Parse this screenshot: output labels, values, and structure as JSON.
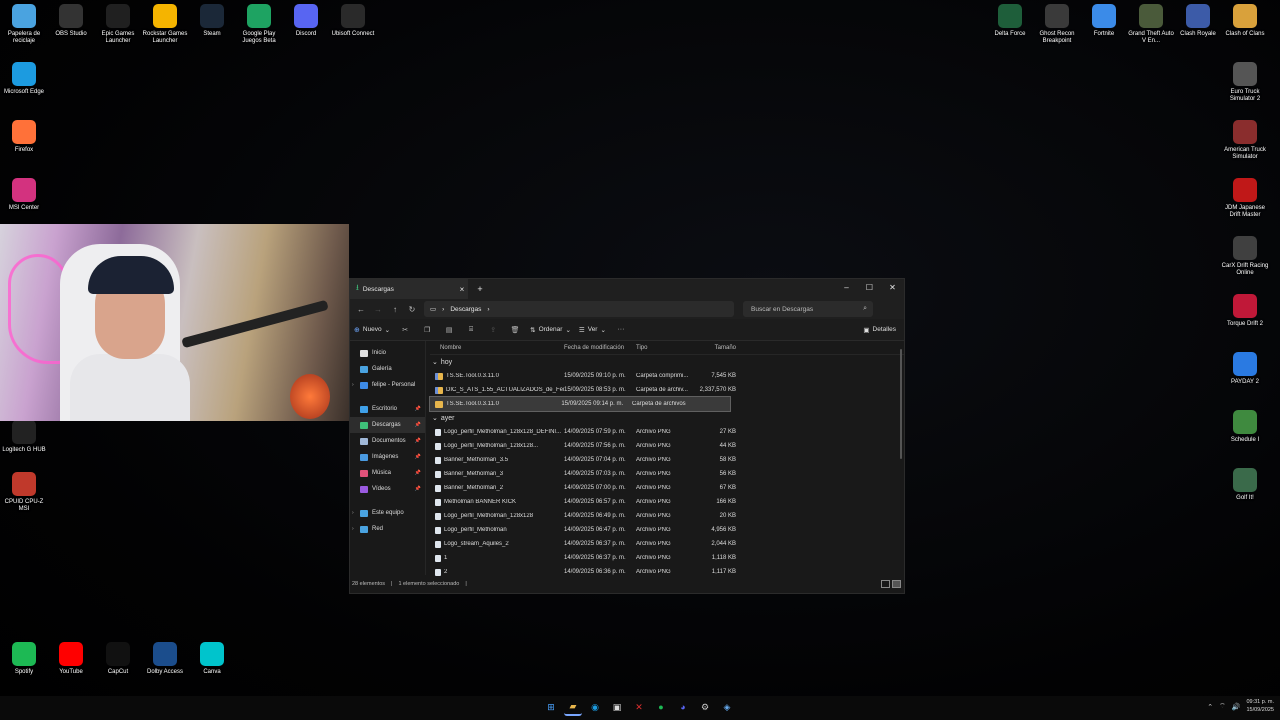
{
  "desktop": {
    "icons_left_row": [
      {
        "label": "Papelera de reciclaje",
        "icon": "recycle-bin-icon",
        "color": "#4aa3e0"
      },
      {
        "label": "OBS Studio",
        "icon": "obs-icon",
        "color": "#333333"
      },
      {
        "label": "Epic Games Launcher",
        "icon": "epic-games-icon",
        "color": "#202020"
      },
      {
        "label": "Rockstar Games Launcher",
        "icon": "rockstar-icon",
        "color": "#f5b400"
      },
      {
        "label": "Steam",
        "icon": "steam-icon",
        "color": "#1b2838"
      },
      {
        "label": "Google Play Juegos Beta",
        "icon": "google-play-icon",
        "color": "#1ea362"
      },
      {
        "label": "Discord",
        "icon": "discord-icon",
        "color": "#5865f2"
      },
      {
        "label": "Ubisoft Connect",
        "icon": "ubisoft-icon",
        "color": "#2a2a2a"
      }
    ],
    "icons_left_col": [
      {
        "label": "Microsoft Edge",
        "icon": "edge-icon",
        "color": "#1c9be0"
      },
      {
        "label": "Firefox",
        "icon": "firefox-icon",
        "color": "#ff7139"
      },
      {
        "label": "MSI Center",
        "icon": "msi-center-icon",
        "color": "#d3327f"
      },
      {
        "label": "Logitech G HUB",
        "icon": "logitech-icon",
        "color": "#222222"
      },
      {
        "label": "CPUID CPU-Z MSI",
        "icon": "cpuz-icon",
        "color": "#c0392b"
      }
    ],
    "icons_top_right": [
      {
        "label": "Delta Force",
        "icon": "delta-force-icon",
        "color": "#1e5e3a"
      },
      {
        "label": "Ghost Recon Breakpoint",
        "icon": "ghost-recon-icon",
        "color": "#3a3a3a"
      },
      {
        "label": "Fortnite",
        "icon": "fortnite-icon",
        "color": "#3b8be8"
      },
      {
        "label": "Grand Theft Auto V En...",
        "icon": "gta-icon",
        "color": "#4a5a3a"
      },
      {
        "label": "Clash Royale",
        "icon": "clash-royale-icon",
        "color": "#3c5ba8"
      },
      {
        "label": "Clash of Clans",
        "icon": "clash-of-clans-icon",
        "color": "#d9a13b"
      }
    ],
    "icons_right_col": [
      {
        "label": "Euro Truck Simulator 2",
        "icon": "ets2-icon",
        "color": "#555555"
      },
      {
        "label": "American Truck Simulator",
        "icon": "ats-icon",
        "color": "#8a2d2d"
      },
      {
        "label": "JDM Japanese Drift Master",
        "icon": "jdm-icon",
        "color": "#c01818"
      },
      {
        "label": "CarX Drift Racing Online",
        "icon": "carx-icon",
        "color": "#404040"
      },
      {
        "label": "Torque Drift 2",
        "icon": "torque-drift-icon",
        "color": "#c01838"
      },
      {
        "label": "PAYDAY 2",
        "icon": "payday-icon",
        "color": "#2a7ae2"
      },
      {
        "label": "Schedule I",
        "icon": "schedule-icon",
        "color": "#3f8a3f"
      },
      {
        "label": "Golf It!",
        "icon": "golf-it-icon",
        "color": "#3a6a4a"
      }
    ],
    "icons_bottom_row": [
      {
        "label": "Spotify",
        "icon": "spotify-icon",
        "color": "#1db954"
      },
      {
        "label": "YouTube",
        "icon": "youtube-icon",
        "color": "#ff0000"
      },
      {
        "label": "CapCut",
        "icon": "capcut-icon",
        "color": "#111111"
      },
      {
        "label": "Dolby Access",
        "icon": "dolby-icon",
        "color": "#1b4d8c"
      },
      {
        "label": "Canva",
        "icon": "canva-icon",
        "color": "#00c4cc"
      }
    ]
  },
  "explorer": {
    "tab_title": "Descargas",
    "address_path": "Descargas",
    "search_placeholder": "Buscar en Descargas",
    "toolbar": {
      "new_label": "Nuevo",
      "sort_label": "Ordenar",
      "view_label": "Ver",
      "details_label": "Detalles"
    },
    "sidebar": [
      {
        "label": "Inicio",
        "icon": "home-icon",
        "color": "#e0e0e0"
      },
      {
        "label": "Galería",
        "icon": "gallery-icon",
        "color": "#4aa3e0"
      },
      {
        "label": "felipe - Personal",
        "icon": "onedrive-icon",
        "color": "#3d8ae6",
        "expandable": true
      },
      {
        "label": "Escritorio",
        "icon": "desktop-icon",
        "color": "#3fa0e8",
        "pinned": true
      },
      {
        "label": "Descargas",
        "icon": "downloads-icon",
        "color": "#3fc07a",
        "pinned": true,
        "selected": true
      },
      {
        "label": "Documentos",
        "icon": "documents-icon",
        "color": "#a0b8d8",
        "pinned": true
      },
      {
        "label": "Imágenes",
        "icon": "pictures-icon",
        "color": "#4a9ae0",
        "pinned": true
      },
      {
        "label": "Música",
        "icon": "music-icon",
        "color": "#e0527a",
        "pinned": true
      },
      {
        "label": "Vídeos",
        "icon": "videos-icon",
        "color": "#9a5ae0",
        "pinned": true
      },
      {
        "label": "Este equipo",
        "icon": "this-pc-icon",
        "color": "#4aa3e0",
        "expandable": true
      },
      {
        "label": "Red",
        "icon": "network-icon",
        "color": "#4aa3e0",
        "expandable": true
      }
    ],
    "columns": {
      "name": "Nombre",
      "date": "Fecha de modificación",
      "type": "Tipo",
      "size": "Tamaño"
    },
    "groups": [
      {
        "label": "hoy",
        "files": [
          {
            "name": "TS.SE.Tool.0.3.11.0",
            "date": "15/09/2025 09:10 p. m.",
            "type": "Carpeta comprimi...",
            "size": "7,545 KB",
            "kind": "zip"
          },
          {
            "name": "DIC_S_ATS_1.55_ACTUALIZADOS_de_Fer...",
            "date": "15/09/2025 08:53 p. m.",
            "type": "Carpeta de archiv...",
            "size": "2,337,570 KB",
            "kind": "zip"
          },
          {
            "name": "TS.SE.Tool.0.3.11.0",
            "date": "15/09/2025 09:14 p. m.",
            "type": "Carpeta de archivos",
            "size": "",
            "kind": "folder",
            "selected": true
          }
        ]
      },
      {
        "label": "ayer",
        "files": [
          {
            "name": "Logo_perfil_Metholman_128x128_DEFINI...",
            "date": "14/09/2025 07:59 p. m.",
            "type": "Archivo PNG",
            "size": "27 KB",
            "kind": "png"
          },
          {
            "name": "Logo_perfil_Metholman_128x128...",
            "date": "14/09/2025 07:56 p. m.",
            "type": "Archivo PNG",
            "size": "44 KB",
            "kind": "png"
          },
          {
            "name": "Banner_Metholman_3.5",
            "date": "14/09/2025 07:04 p. m.",
            "type": "Archivo PNG",
            "size": "58 KB",
            "kind": "png"
          },
          {
            "name": "Banner_Metholman_3",
            "date": "14/09/2025 07:03 p. m.",
            "type": "Archivo PNG",
            "size": "56 KB",
            "kind": "png"
          },
          {
            "name": "Banner_Metholman_2",
            "date": "14/09/2025 07:00 p. m.",
            "type": "Archivo PNG",
            "size": "67 KB",
            "kind": "png"
          },
          {
            "name": "Metholman BANNER KICK",
            "date": "14/09/2025 06:57 p. m.",
            "type": "Archivo PNG",
            "size": "166 KB",
            "kind": "png"
          },
          {
            "name": "Logo_perfil_Metholman_128x128",
            "date": "14/09/2025 06:49 p. m.",
            "type": "Archivo PNG",
            "size": "20 KB",
            "kind": "png"
          },
          {
            "name": "Logo_perfil_Metholman",
            "date": "14/09/2025 06:47 p. m.",
            "type": "Archivo PNG",
            "size": "4,956 KB",
            "kind": "png"
          },
          {
            "name": "Logo_stream_Aquiles_2",
            "date": "14/09/2025 06:37 p. m.",
            "type": "Archivo PNG",
            "size": "2,044 KB",
            "kind": "png"
          },
          {
            "name": "1",
            "date": "14/09/2025 06:37 p. m.",
            "type": "Archivo PNG",
            "size": "1,118 KB",
            "kind": "png"
          },
          {
            "name": "2",
            "date": "14/09/2025 06:36 p. m.",
            "type": "Archivo PNG",
            "size": "1,117 KB",
            "kind": "png"
          }
        ]
      }
    ],
    "status": {
      "count": "28 elementos",
      "selected": "1 elemento seleccionado"
    }
  },
  "taskbar": {
    "apps": [
      {
        "icon": "windows-start-icon",
        "glyph": "⊞",
        "color": "#4aa3ff"
      },
      {
        "icon": "file-explorer-icon",
        "glyph": "▰",
        "color": "#e8b64c",
        "active": true
      },
      {
        "icon": "edge-icon",
        "glyph": "◉",
        "color": "#1c9be0"
      },
      {
        "icon": "store-icon",
        "glyph": "▣",
        "color": "#dddddd"
      },
      {
        "icon": "x-icon",
        "glyph": "✕",
        "color": "#e03030"
      },
      {
        "icon": "spotify-icon",
        "glyph": "●",
        "color": "#1db954"
      },
      {
        "icon": "discord-icon",
        "glyph": "◕",
        "color": "#5865f2"
      },
      {
        "icon": "settings-icon",
        "glyph": "⚙",
        "color": "#cccccc"
      },
      {
        "icon": "steam-icon",
        "glyph": "◈",
        "color": "#66aaee"
      }
    ],
    "clock_time": "09:31 p. m.",
    "clock_date": "15/09/2025"
  }
}
